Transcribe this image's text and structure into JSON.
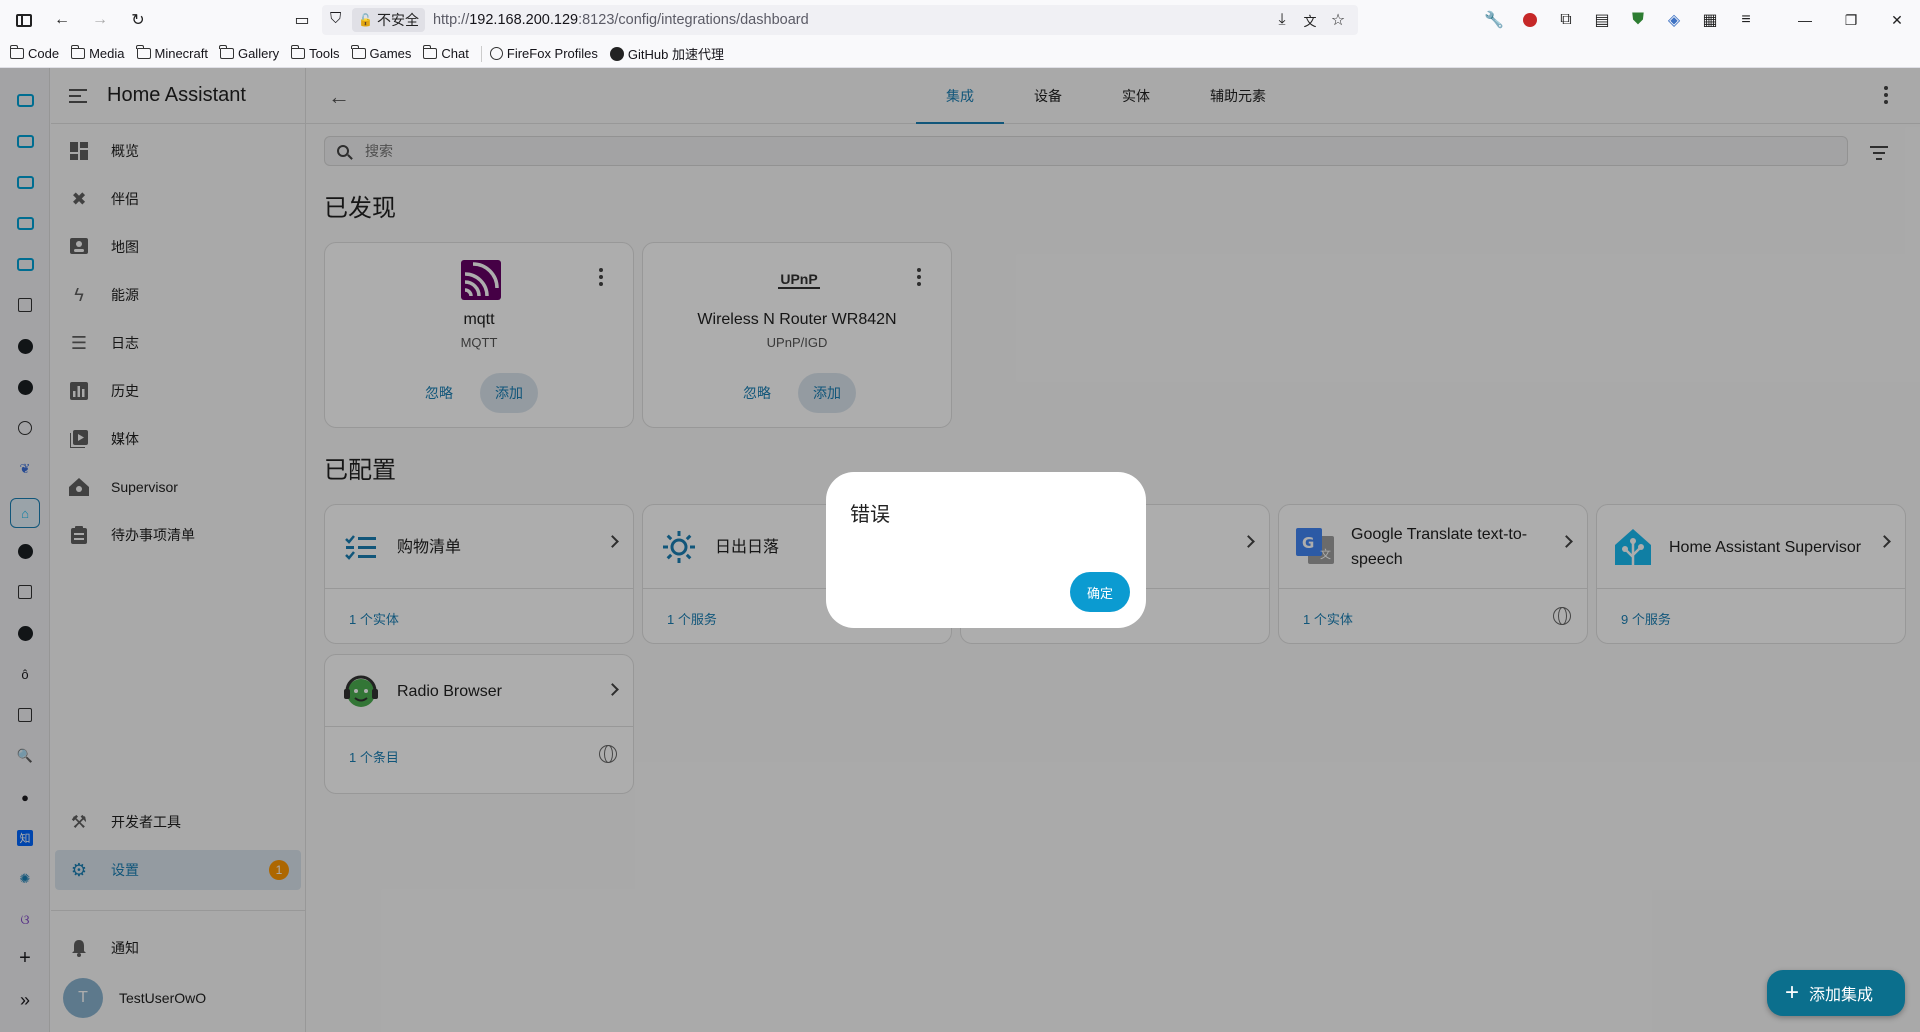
{
  "browser": {
    "security_label": "不安全",
    "url_prefix": "http://",
    "url_host": "192.168.200.129",
    "url_rest": ":8123/config/integrations/dashboard",
    "bookmarks": [
      "Code",
      "Media",
      "Minecraft",
      "Gallery",
      "Tools",
      "Games",
      "Chat",
      "FireFox Profiles",
      "GitHub 加速代理"
    ]
  },
  "ha_sidebar": {
    "title": "Home Assistant",
    "items": [
      {
        "label": "概览",
        "icon": "dashboard-icon"
      },
      {
        "label": "伴侣",
        "icon": "tools-icon"
      },
      {
        "label": "地图",
        "icon": "map-icon"
      },
      {
        "label": "能源",
        "icon": "lightning-icon"
      },
      {
        "label": "日志",
        "icon": "logbook-icon"
      },
      {
        "label": "历史",
        "icon": "chart-icon"
      },
      {
        "label": "媒体",
        "icon": "media-icon"
      },
      {
        "label": "Supervisor",
        "icon": "supervisor-icon"
      },
      {
        "label": "待办事项清单",
        "icon": "clipboard-icon"
      }
    ],
    "dev_tools": "开发者工具",
    "settings": "设置",
    "settings_badge": "1",
    "notifications": "通知",
    "user_initial": "T",
    "user_name": "TestUserOwO"
  },
  "main": {
    "tabs": [
      "集成",
      "设备",
      "实体",
      "辅助元素"
    ],
    "search_placeholder": "搜索",
    "discovered_title": "已发现",
    "configured_title": "已配置",
    "discovered": [
      {
        "name": "mqtt",
        "sub": "MQTT",
        "ignore": "忽略",
        "add": "添加"
      },
      {
        "name": "Wireless N Router WR842N",
        "sub": "UPnP/IGD",
        "ignore": "忽略",
        "add": "添加",
        "logo_text": "UPnP"
      }
    ],
    "configured": [
      {
        "name": "购物清单",
        "foot": "1 个实体"
      },
      {
        "name": "日出日落",
        "foot": "1 个服务"
      },
      {
        "name": "",
        "foot": ""
      },
      {
        "name": "Google Translate text-to-speech",
        "foot": "1 个实体"
      },
      {
        "name": "Home Assistant Supervisor",
        "foot": "9 个服务"
      },
      {
        "name": "Radio Browser",
        "foot": "1 个条目"
      }
    ],
    "fab_label": "添加集成"
  },
  "dialog": {
    "title": "错误",
    "ok": "确定"
  },
  "colors": {
    "accent": "#1a7fb4",
    "badge": "#ff9800",
    "fab": "#0b6f8d",
    "mqtt": "#660066"
  }
}
